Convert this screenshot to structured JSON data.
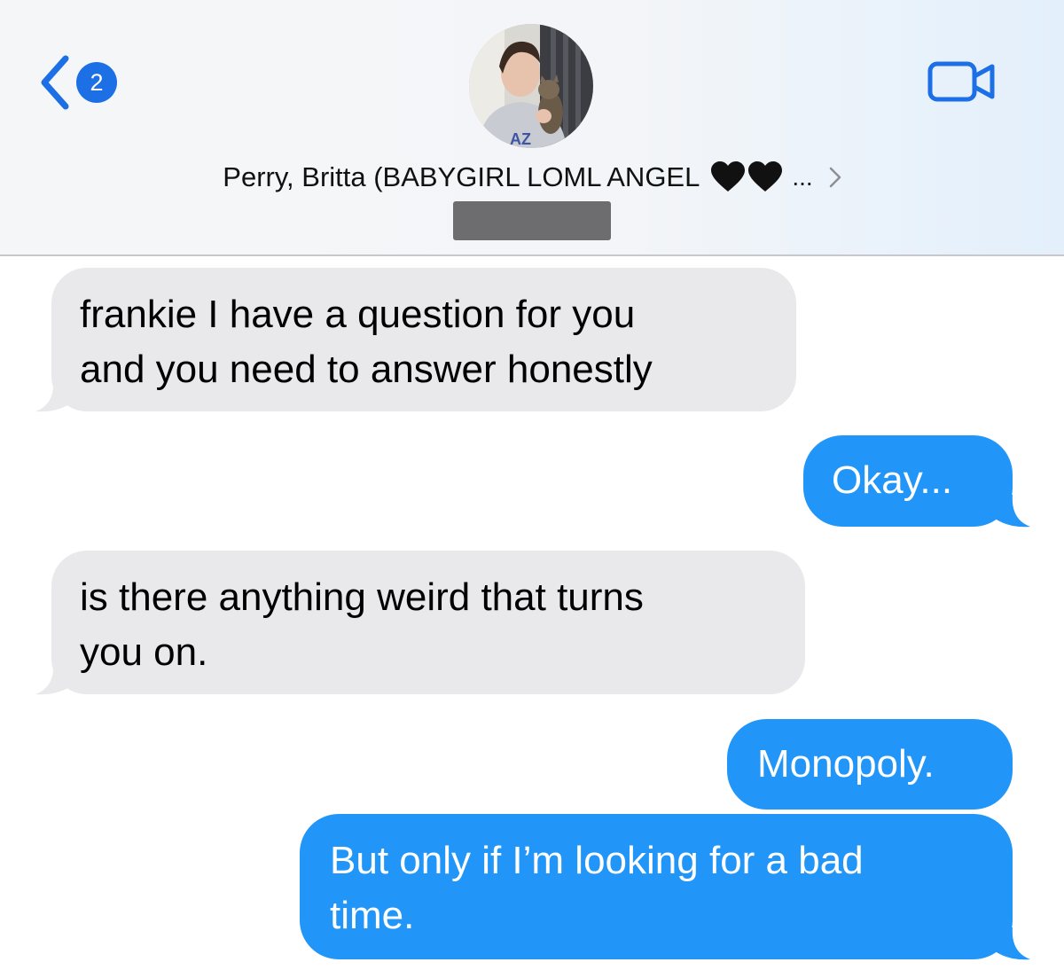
{
  "header": {
    "back_badge_count": "2",
    "contact_name": "Perry, Britta (BABYGIRL LOML ANGEL",
    "contact_hearts": [
      "🖤",
      "🖤"
    ],
    "contact_ellipsis": "...",
    "icons": {
      "back": "chevron-left-icon",
      "video": "video-camera-icon",
      "detail": "chevron-right-icon"
    },
    "accent_color": "#1d6fe6"
  },
  "messages": [
    {
      "direction": "received",
      "lines": [
        "frankie I have a question for you",
        "and you need to answer honestly"
      ]
    },
    {
      "direction": "sent",
      "lines": [
        "Okay..."
      ]
    },
    {
      "direction": "received",
      "lines": [
        "is there anything weird that turns",
        "you on."
      ]
    },
    {
      "direction": "sent",
      "lines": [
        "Monopoly."
      ]
    },
    {
      "direction": "sent",
      "lines": [
        "But only if I’m looking for a bad",
        "time."
      ]
    }
  ],
  "colors": {
    "received_bubble": "#e9e9eb",
    "sent_bubble": "#2196f8"
  }
}
